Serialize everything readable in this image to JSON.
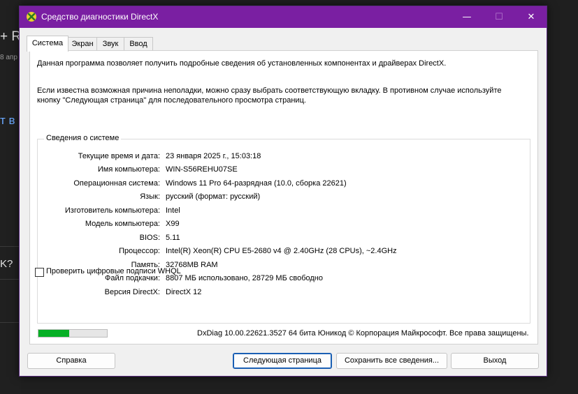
{
  "background": {
    "fragments": [
      "+ R",
      "8 апр",
      "т в",
      "K?"
    ]
  },
  "window": {
    "title": "Средство диагностики DirectX",
    "app_icon": "directx-icon",
    "controls": {
      "minimize": "—",
      "maximize": "☐",
      "close": "✕"
    },
    "accent": "#7a1fa2"
  },
  "tabs": [
    {
      "label": "Система",
      "active": true
    },
    {
      "label": "Экран",
      "active": false
    },
    {
      "label": "Звук",
      "active": false
    },
    {
      "label": "Ввод",
      "active": false
    }
  ],
  "intro": {
    "line1": "Данная программа позволяет получить подробные сведения об установленных компонентах и драйверах DirectX.",
    "line2": "Если известна возможная причина неполадки, можно сразу выбрать соответствующую вкладку. В противном случае используйте",
    "line3": "кнопку \"Следующая страница\" для последовательного просмотра страниц."
  },
  "system_info": {
    "title": "Сведения о системе",
    "rows": [
      {
        "label": "Текущие время и дата:",
        "value": "23 января 2025 г., 15:03:18"
      },
      {
        "label": "Имя компьютера:",
        "value": "WIN-S56REHU07SE"
      },
      {
        "label": "Операционная система:",
        "value": "Windows 11 Pro 64-разрядная (10.0, сборка 22621)"
      },
      {
        "label": "Язык:",
        "value": "русский (формат: русский)"
      },
      {
        "label": "Изготовитель компьютера:",
        "value": "Intel"
      },
      {
        "label": "Модель компьютера:",
        "value": "X99"
      },
      {
        "label": "BIOS:",
        "value": "5.11"
      },
      {
        "label": "Процессор:",
        "value": "Intel(R) Xeon(R) CPU E5-2680 v4 @ 2.40GHz (28 CPUs), ~2.4GHz"
      },
      {
        "label": "Память:",
        "value": "32768MB RAM"
      },
      {
        "label": "Файл подкачки:",
        "value": "8807 МБ использовано, 28729 МБ свободно"
      },
      {
        "label": "Версия DirectX:",
        "value": "DirectX 12"
      }
    ]
  },
  "whql_checkbox": {
    "label": "Проверить цифровые подписи WHQL",
    "checked": false
  },
  "progress": {
    "fraction": 0.45,
    "color": "#06b025"
  },
  "copyright": "DxDiag 10.00.22621.3527 64 бита Юникод © Корпорация Майкрософт. Все права защищены.",
  "buttons": {
    "help": "Справка",
    "next_page": "Следующая страница",
    "save_all": "Сохранить все сведения...",
    "exit": "Выход"
  }
}
